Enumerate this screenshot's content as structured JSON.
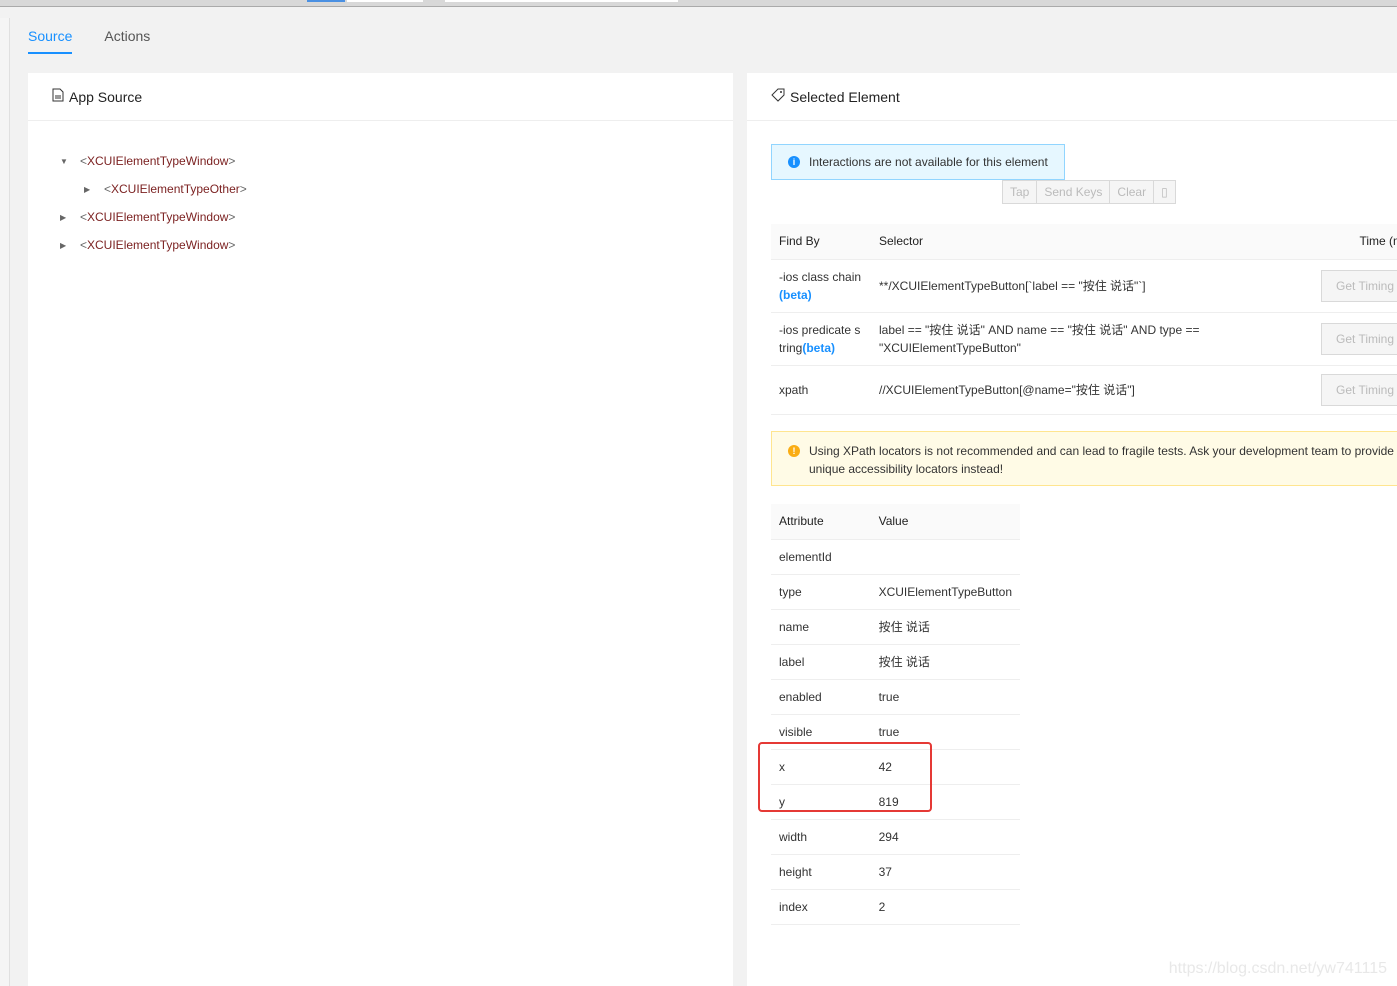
{
  "tabs": [
    {
      "label": "Source",
      "active": true
    },
    {
      "label": "Actions",
      "active": false
    }
  ],
  "app_source": {
    "title": "App Source",
    "icon": "file-icon",
    "tree": [
      {
        "tag": "XCUIElementTypeWindow",
        "expanded": true,
        "level": 0
      },
      {
        "tag": "XCUIElementTypeOther",
        "expanded": false,
        "level": 1
      },
      {
        "tag": "XCUIElementTypeWindow",
        "expanded": false,
        "level": 0
      },
      {
        "tag": "XCUIElementTypeWindow",
        "expanded": false,
        "level": 0
      }
    ]
  },
  "selected": {
    "title": "Selected Element",
    "icon": "tag-icon",
    "info": "Interactions are not available for this element",
    "buttons": {
      "tap": "Tap",
      "send_keys": "Send Keys",
      "clear": "Clear"
    },
    "selector_headers": {
      "find_by": "Find By",
      "selector": "Selector",
      "time": "Time (m"
    },
    "selectors": [
      {
        "find_by": "-ios class chain ",
        "beta": "(beta)",
        "selector": "**/XCUIElementTypeButton[`label == \"按住 说话\"`]",
        "button": "Get Timing"
      },
      {
        "find_by": "-ios predicate string",
        "beta": "(beta)",
        "selector": "label == \"按住 说话\" AND name == \"按住 说话\" AND type == \"XCUIElementTypeButton\"",
        "button": "Get Timing"
      },
      {
        "find_by": "xpath",
        "beta": "",
        "selector": "//XCUIElementTypeButton[@name=\"按住 说话\"]",
        "button": "Get Timing"
      }
    ],
    "warning": "Using XPath locators is not recommended and can lead to fragile tests. Ask your development team to provide unique accessibility locators instead!",
    "attr_headers": {
      "attribute": "Attribute",
      "value": "Value"
    },
    "attributes": [
      [
        "elementId",
        ""
      ],
      [
        "type",
        "XCUIElementTypeButton"
      ],
      [
        "name",
        "按住 说话"
      ],
      [
        "label",
        "按住 说话"
      ],
      [
        "enabled",
        "true"
      ],
      [
        "visible",
        "true"
      ],
      [
        "x",
        "42"
      ],
      [
        "y",
        "819"
      ],
      [
        "width",
        "294"
      ],
      [
        "height",
        "37"
      ],
      [
        "index",
        "2"
      ]
    ]
  },
  "colors": {
    "accent": "#1890ff",
    "tag_text": "#7a1f1f",
    "highlight": "#e53935"
  },
  "watermark": "https://blog.csdn.net/yw741115"
}
